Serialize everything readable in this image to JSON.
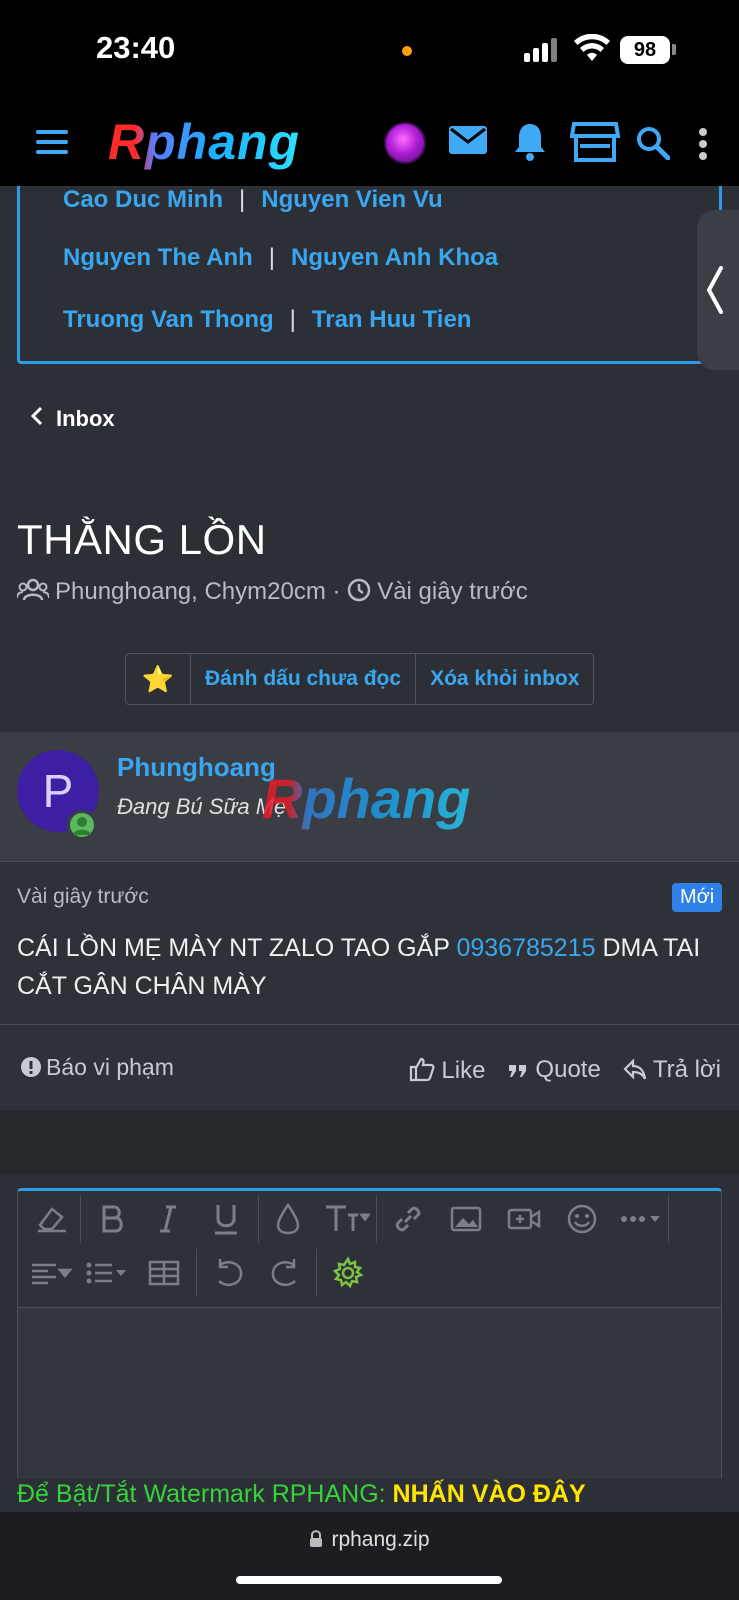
{
  "status": {
    "time": "23:40",
    "battery": "98"
  },
  "header": {
    "logo": "Rphang"
  },
  "names": [
    [
      "Cao Duc Minh",
      "Nguyen Vien Vu"
    ],
    [
      "Nguyen The Anh",
      "Nguyen Anh Khoa"
    ],
    [
      "Truong Van Thong",
      "Tran Huu Tien"
    ]
  ],
  "breadcrumb": "Inbox",
  "thread": {
    "title": "THẰNG LỒN",
    "participants": "Phunghoang, Chym20cm",
    "separator": "·",
    "time": "Vài giây trước"
  },
  "actions": {
    "star": "⭐",
    "mark_unread": "Đánh dấu chưa đọc",
    "remove": "Xóa khỏi inbox"
  },
  "message": {
    "avatar_letter": "P",
    "username": "Phunghoang",
    "user_title": "Đang Bú Sữa Mẹ",
    "watermark": "Rphang",
    "time": "Vài giây trước",
    "badge": "Mới",
    "text_before": "CÁI LỒN MẸ MÀY NT ZALO TAO GẮP ",
    "phone": "0936785215",
    "text_after": " DMA TAI CẮT GÂN CHÂN MÀY",
    "report": "Báo vi phạm",
    "like": "Like",
    "quote": "Quote",
    "reply": "Trả lời"
  },
  "watermark_toggle": {
    "label": "Để Bật/Tắt Watermark RPHANG: ",
    "link": "NHẤN VÀO ĐÂY"
  },
  "browser": {
    "url": "rphang.zip"
  },
  "colors": {
    "accent": "#39a7f0",
    "green": "#35d43a",
    "yellow": "#ffe600",
    "badge": "#2f81e8"
  }
}
